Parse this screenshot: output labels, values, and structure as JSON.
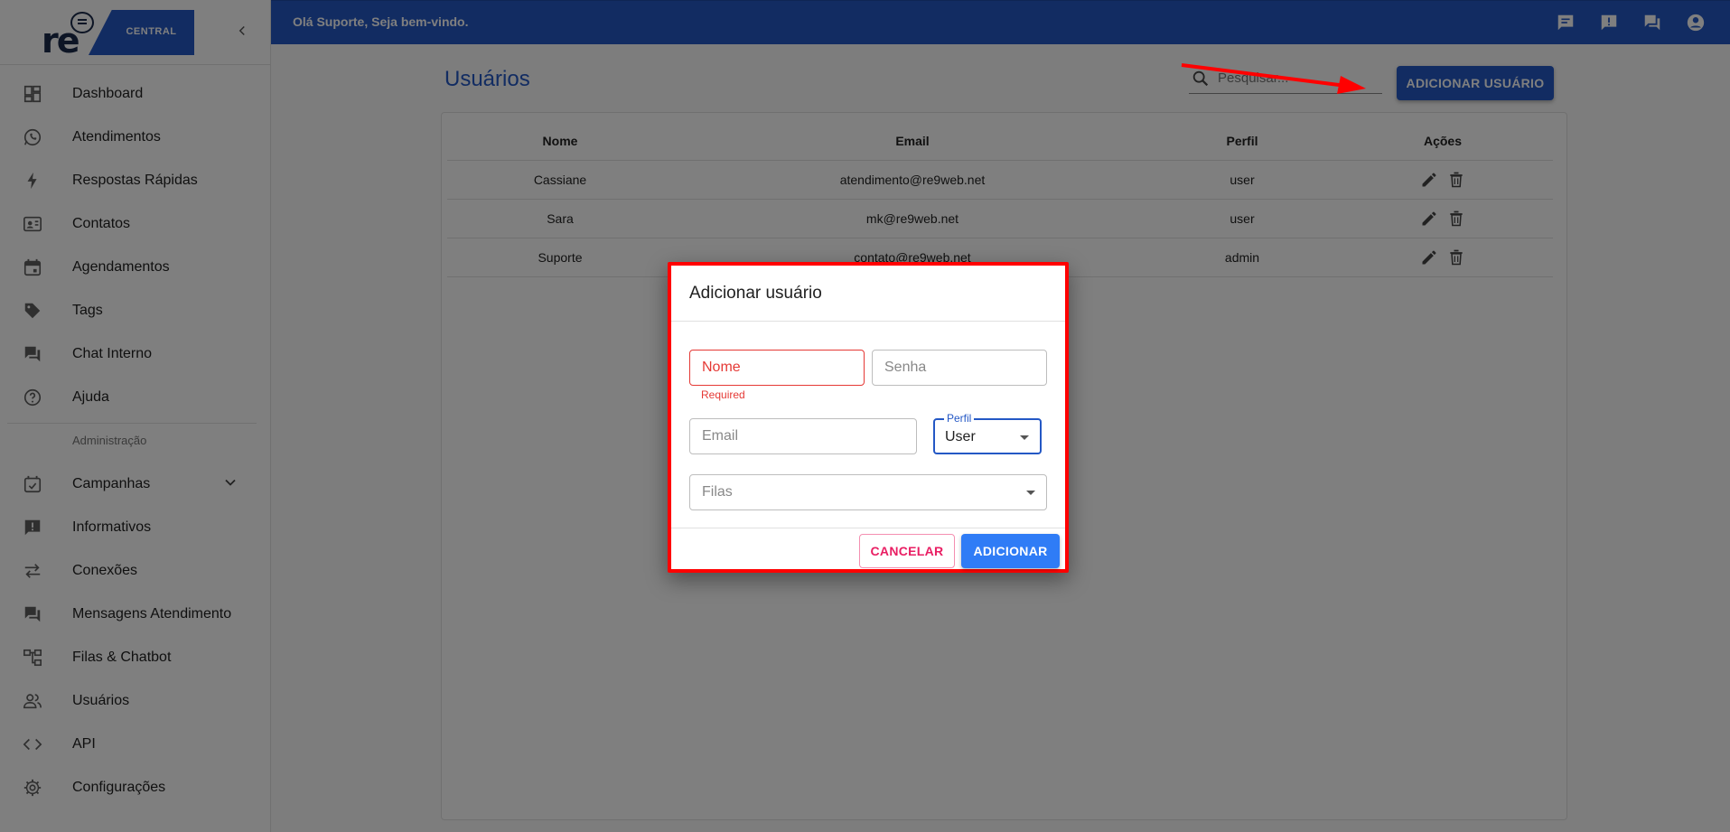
{
  "brand": {
    "logo_text": "CENTRAL"
  },
  "topbar": {
    "greeting": "Olá Suporte, Seja bem-vindo."
  },
  "sidebar": {
    "items": [
      {
        "label": "Dashboard"
      },
      {
        "label": "Atendimentos"
      },
      {
        "label": "Respostas Rápidas"
      },
      {
        "label": "Contatos"
      },
      {
        "label": "Agendamentos"
      },
      {
        "label": "Tags"
      },
      {
        "label": "Chat Interno"
      },
      {
        "label": "Ajuda"
      }
    ],
    "section_label": "Administração",
    "admin_items": [
      {
        "label": "Campanhas"
      },
      {
        "label": "Informativos"
      },
      {
        "label": "Conexões"
      },
      {
        "label": "Mensagens Atendimento"
      },
      {
        "label": "Filas & Chatbot"
      },
      {
        "label": "Usuários"
      },
      {
        "label": "API"
      },
      {
        "label": "Configurações"
      }
    ]
  },
  "main": {
    "title": "Usuários",
    "search_placeholder": "Pesquisar...",
    "add_button": "ADICIONAR USUÁRIO",
    "table": {
      "headers": [
        "Nome",
        "Email",
        "Perfil",
        "Ações"
      ],
      "rows": [
        {
          "nome": "Cassiane",
          "email": "atendimento@re9web.net",
          "perfil": "user"
        },
        {
          "nome": "Sara",
          "email": "mk@re9web.net",
          "perfil": "user"
        },
        {
          "nome": "Suporte",
          "email": "contato@re9web.net",
          "perfil": "admin"
        }
      ]
    }
  },
  "dialog": {
    "title": "Adicionar usuário",
    "nome_placeholder": "Nome",
    "nome_error": "Required",
    "senha_placeholder": "Senha",
    "email_placeholder": "Email",
    "perfil_label": "Perfil",
    "perfil_value": "User",
    "filas_placeholder": "Filas",
    "cancel_label": "CANCELAR",
    "add_label": "ADICIONAR"
  },
  "colors": {
    "primary": "#2458c5",
    "error": "#e53935",
    "cancel": "#e91e63",
    "annotation": "#ff0000"
  }
}
